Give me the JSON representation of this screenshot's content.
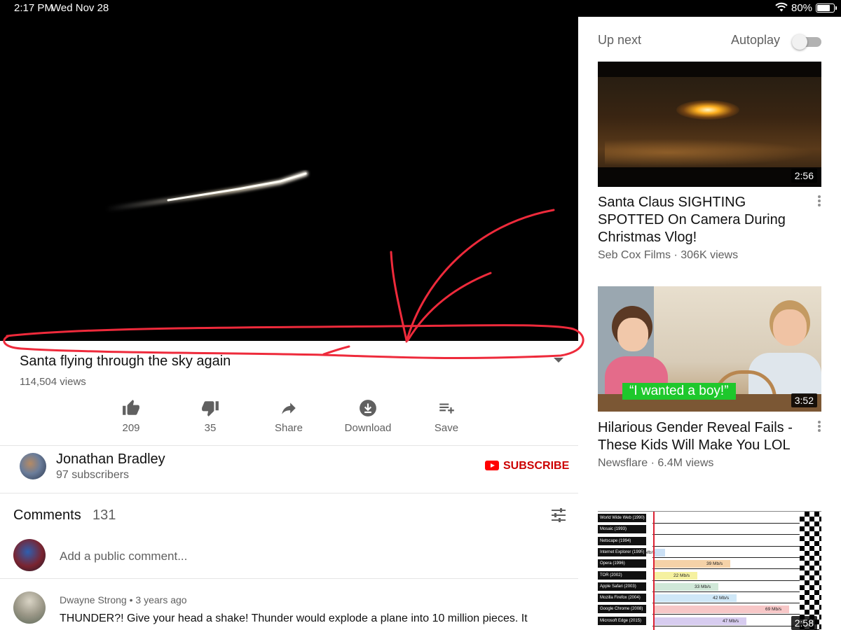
{
  "status_bar": {
    "time": "2:17 PM",
    "date": "Wed Nov 28",
    "battery": "80%",
    "battery_level": 0.8
  },
  "video": {
    "title": "Santa flying through the sky again",
    "views": "114,504 views",
    "actions": [
      {
        "id": "like",
        "label": "209"
      },
      {
        "id": "dislike",
        "label": "35"
      },
      {
        "id": "share",
        "label": "Share"
      },
      {
        "id": "download",
        "label": "Download"
      },
      {
        "id": "save",
        "label": "Save"
      }
    ]
  },
  "channel": {
    "name": "Jonathan Bradley",
    "subscribers": "97 subscribers",
    "subscribe_label": "SUBSCRIBE"
  },
  "comments": {
    "heading": "Comments",
    "count": "131",
    "add_placeholder": "Add a public comment...",
    "items": [
      {
        "author": "Dwayne Strong",
        "age": "3 years ago",
        "text": "THUNDER?! Give your head a shake! Thunder would explode a plane into 10 million pieces. It"
      }
    ]
  },
  "sidebar": {
    "up_next_label": "Up next",
    "autoplay_label": "Autoplay",
    "autoplay_on": false,
    "recommendations": [
      {
        "title": "Santa Claus SIGHTING SPOTTED On Camera During Christmas Vlog!",
        "channel": "Seb Cox Films",
        "views": "306K views",
        "duration": "2:56"
      },
      {
        "title": "Hilarious Gender Reveal Fails - These Kids Will Make You LOL",
        "channel": "Newsflare",
        "views": "6.4M views",
        "duration": "3:52",
        "thumb_caption": "“I wanted a boy!”"
      },
      {
        "duration": "2:58",
        "thumb_rows": [
          {
            "label": "World Wide Web (1990)"
          },
          {
            "label": "Mosaic (1993)"
          },
          {
            "label": "Netscape (1994)"
          },
          {
            "label": "Internet Explorer (1995)",
            "speed": "4 Mb/s"
          },
          {
            "label": "Opera (1996)",
            "speed": "39 Mb/s"
          },
          {
            "label": "TOR (2002)",
            "speed": "22 Mb/s"
          },
          {
            "label": "Apple Safari (2003)",
            "speed": "33 Mb/s"
          },
          {
            "label": "Mozilla Firefox (2004)",
            "speed": "42 Mb/s"
          },
          {
            "label": "Google Chrome (2008)",
            "speed": "69 Mb/s"
          },
          {
            "label": "Microsoft Edge (2015)",
            "speed": "47 Mb/s"
          }
        ]
      }
    ]
  },
  "colors": {
    "brand_red": "#ff0000",
    "subscribe_red": "#cc0000",
    "annotation_red": "#ee2a3b"
  }
}
